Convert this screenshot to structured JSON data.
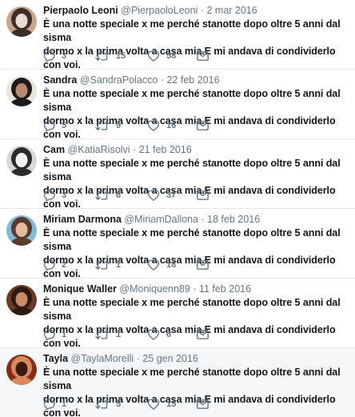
{
  "tweets": [
    {
      "name": "Pierpaolo Leoni",
      "handle": "@PierpaoloLeoni",
      "separator": "·",
      "date": "2 mar 2016",
      "text_line1": "È una notte speciale x me perché stanotte dopo oltre 5 anni dal sisma",
      "text_line2": "dormo x la prima volta a casa mia.E mi andava di condividerlo con voi.",
      "replies": "3",
      "retweets": "15",
      "likes": "58",
      "avatar_colors": [
        "#c9a48a",
        "#3a2e2a",
        "#e8dcd0"
      ]
    },
    {
      "name": "Sandra",
      "handle": "@SandraPolacco",
      "separator": "·",
      "date": "22 feb 2016",
      "text_line1": "È una notte speciale x me perché stanotte dopo oltre 5 anni dal sisma",
      "text_line2": "dormo x la prima volta a casa mia.E mi andava di condividerlo con voi.",
      "replies": "5",
      "retweets": "9",
      "likes": "16",
      "avatar_colors": [
        "#e9e4dc",
        "#1e1a18",
        "#b68a6e"
      ]
    },
    {
      "name": "Cam",
      "handle": "@KatiaRisolvi",
      "separator": "·",
      "date": "21 feb 2016",
      "text_line1": "È una notte speciale x me perché stanotte dopo oltre 5 anni dal sisma",
      "text_line2": "dormo x la prima volta a casa mia.E mi andava di condividerlo con voi.",
      "replies": "3",
      "retweets": "6",
      "likes": "37",
      "avatar_colors": [
        "#d8d8d8",
        "#2b2b2b",
        "#f2f2f2"
      ]
    },
    {
      "name": "Miriam Darmona",
      "handle": "@MiriamDallona",
      "separator": "·",
      "date": "18 feb 2016",
      "text_line1": "È una notte speciale x me perché stanotte dopo oltre 5 anni dal sisma",
      "text_line2": "dormo x la prima volta a casa mia.E mi andava di condividerlo con voi.",
      "replies": "2",
      "retweets": "1",
      "likes": "18",
      "avatar_colors": [
        "#7fb8d8",
        "#5a3a2a",
        "#e3b9a0"
      ]
    },
    {
      "name": "Monique Waller",
      "handle": "@Moniquenn89",
      "separator": "·",
      "date": "11 feb 2016",
      "text_line1": "È una notte speciale x me perché stanotte dopo oltre 5 anni dal sisma",
      "text_line2": "dormo x la prima volta a casa mia.E mi andava di condividerlo con voi.",
      "replies": "1",
      "retweets": "1",
      "likes": "6",
      "avatar_colors": [
        "#6b3a24",
        "#2a1a12",
        "#c98a66"
      ]
    },
    {
      "name": "Tayla",
      "handle": "@TaylaMorelli",
      "separator": "·",
      "date": "25 gen 2016",
      "text_line1": "È una notte speciale x me perché stanotte dopo oltre 5 anni dal sisma",
      "text_line2": "dormo x la prima volta a casa mia.E mi andava di condividerlo con voi.",
      "replies": "1",
      "retweets": "5",
      "likes": "15",
      "avatar_colors": [
        "#8a2a1a",
        "#d88a5a",
        "#3a1a10"
      ]
    }
  ],
  "icons": {
    "reply": "reply-icon",
    "retweet": "retweet-icon",
    "like": "heart-icon",
    "message": "envelope-icon"
  },
  "colors": {
    "text": "#14171a",
    "muted": "#657786",
    "divider": "#e6ecf0",
    "highlight_bg": "#f5f8fa"
  }
}
